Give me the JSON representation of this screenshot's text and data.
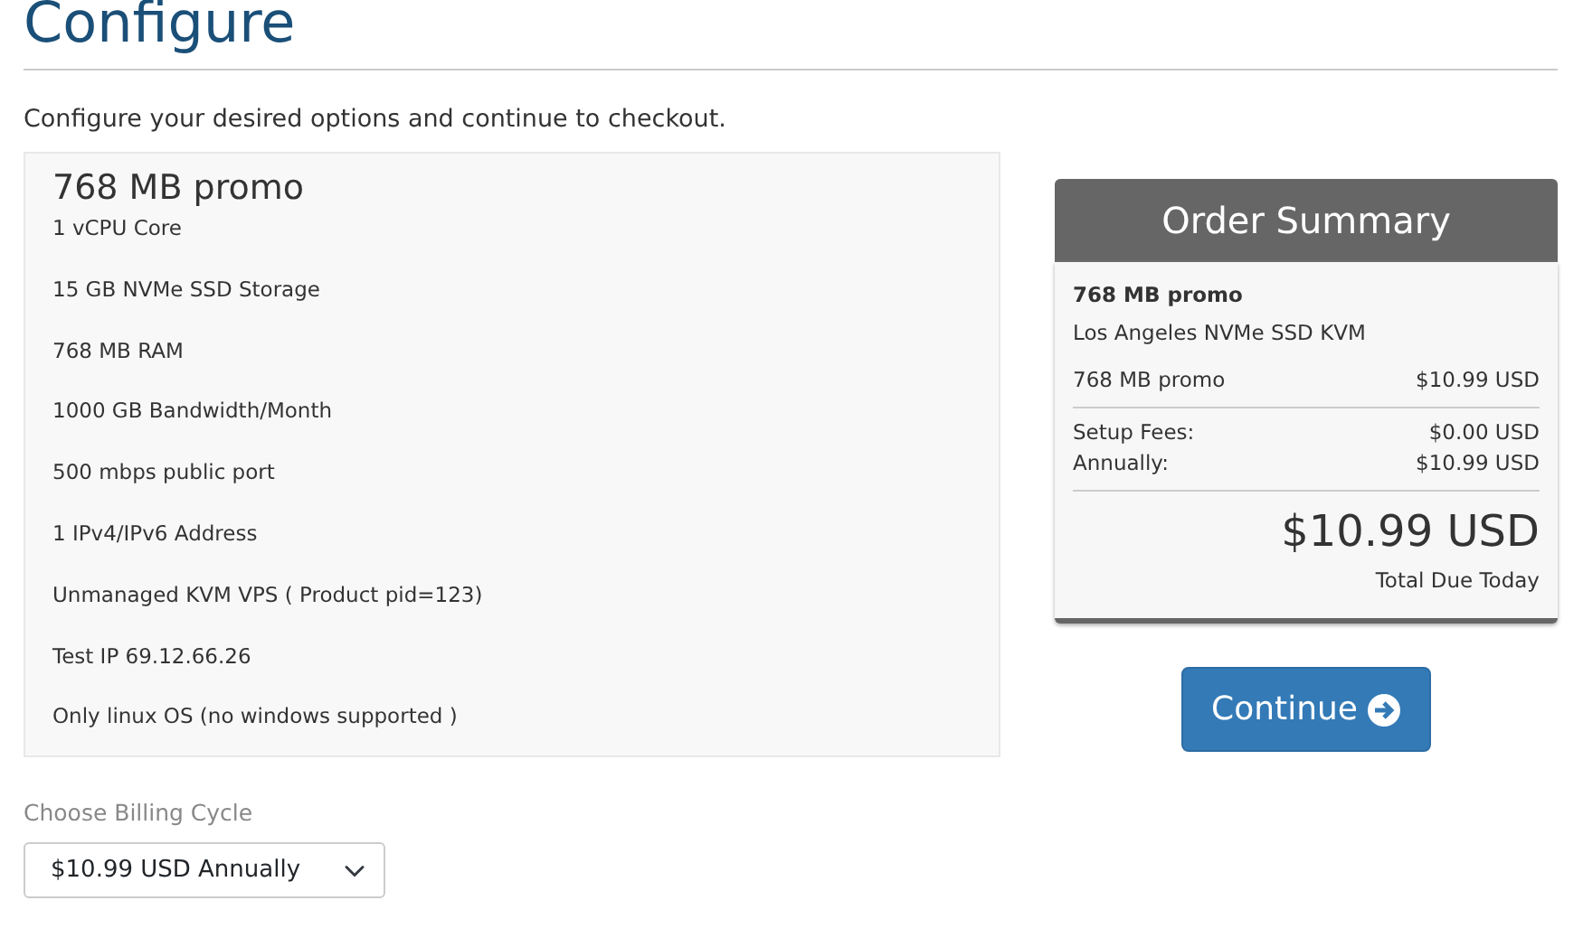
{
  "page_title": "Configure",
  "intro": "Configure your desired options and continue to checkout.",
  "product": {
    "name": "768 MB promo",
    "features": [
      "1 vCPU Core",
      "15 GB NVMe SSD Storage",
      "768 MB RAM",
      "1000 GB Bandwidth/Month",
      "500 mbps public port",
      "1 IPv4/IPv6 Address",
      "Unmanaged KVM VPS ( Product pid=123)",
      "Test IP 69.12.66.26",
      "Only linux OS (no windows supported )"
    ]
  },
  "billing_cycle": {
    "label": "Choose Billing Cycle",
    "value": "$10.99 USD Annually"
  },
  "order_summary": {
    "title": "Order Summary",
    "product_name": "768 MB promo",
    "product_group": "Los Angeles NVMe SSD KVM",
    "line_items": [
      {
        "label": "768 MB promo",
        "amount": "$10.99 USD"
      }
    ],
    "fees": [
      {
        "label": "Setup Fees:",
        "amount": "$0.00 USD"
      },
      {
        "label": "Annually:",
        "amount": "$10.99 USD"
      }
    ],
    "total": "$10.99 USD",
    "total_label": "Total Due Today"
  },
  "continue_button": "Continue"
}
